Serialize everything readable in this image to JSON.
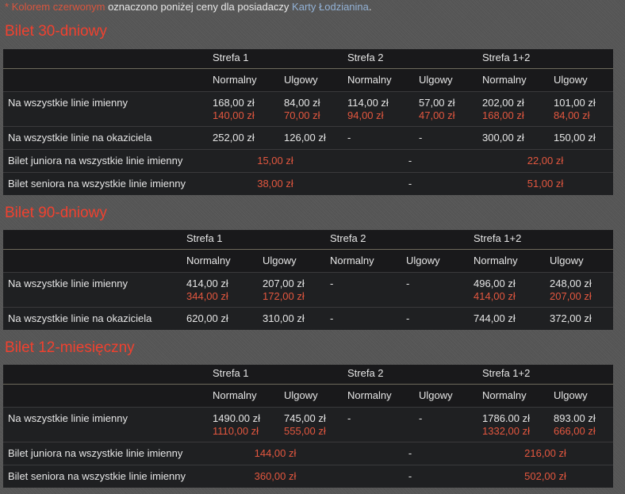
{
  "intro": {
    "star": "*",
    "red_text": "Kolorem czerwonym",
    "text": " oznaczono poniżej ceny dla posiadaczy ",
    "link": "Karty Łodzianina",
    "end": "."
  },
  "colors": {
    "discount": "#e4573f",
    "title": "#f0412f",
    "link": "#93b2d6"
  },
  "sections": [
    {
      "title": "Bilet 30-dniowy",
      "zones": [
        "Strefa 1",
        "Strefa 2",
        "Strefa 1+2"
      ],
      "types": [
        "Normalny",
        "Ulgowy",
        "Normalny",
        "Ulgowy",
        "Normalny",
        "Ulgowy"
      ],
      "rows": [
        {
          "label": "Na wszystkie linie imienny",
          "prices": [
            "168,00 zł",
            "84,00 zł",
            "114,00 zł",
            "57,00 zł",
            "202,00 zł",
            "101,00 zł"
          ],
          "card_prices": [
            "140,00 zł",
            "70,00 zł",
            "94,00 zł",
            "47,00 zł",
            "168,00 zł",
            "84,00 zł"
          ]
        },
        {
          "label": "Na wszystkie linie na okaziciela",
          "prices": [
            "252,00 zł",
            "126,00 zł",
            "-",
            "-",
            "300,00 zł",
            "150,00 zł"
          ]
        },
        {
          "label": "Bilet juniora na wszystkie linie imienny",
          "zone_prices": [
            "15,00 zł",
            "-",
            "22,00 zł"
          ]
        },
        {
          "label": "Bilet seniora na wszystkie linie imienny",
          "zone_prices": [
            "38,00 zł",
            "-",
            "51,00 zł"
          ]
        }
      ]
    },
    {
      "title": "Bilet 90-dniowy",
      "zones": [
        "Strefa 1",
        "Strefa 2",
        "Strefa 1+2"
      ],
      "types": [
        "Normalny",
        "Ulgowy",
        "Normalny",
        "Ulgowy",
        "Normalny",
        "Ulgowy"
      ],
      "rows": [
        {
          "label": "Na wszystkie linie imienny",
          "prices": [
            "414,00 zł",
            "207,00 zł",
            "-",
            "-",
            "496,00 zł",
            "248,00 zł"
          ],
          "card_prices": [
            "344,00 zł",
            "172,00 zł",
            "",
            "",
            "414,00 zł",
            "207,00 zł"
          ]
        },
        {
          "label": "Na wszystkie linie na okaziciela",
          "prices": [
            "620,00 zł",
            "310,00 zł",
            "-",
            "-",
            "744,00 zł",
            "372,00 zł"
          ]
        }
      ]
    },
    {
      "title": "Bilet 12-miesięczny",
      "zones": [
        "Strefa 1",
        "Strefa 2",
        "Strefa 1+2"
      ],
      "types": [
        "Normalny",
        "Ulgowy",
        "Normalny",
        "Ulgowy",
        "Normalny",
        "Ulgowy"
      ],
      "rows": [
        {
          "label": "Na wszystkie linie imienny",
          "prices": [
            "1490.00 zł",
            "745,00 zł",
            "-",
            "-",
            "1786.00 zł",
            "893.00 zł"
          ],
          "card_prices": [
            "1110,00 zł",
            "555,00 zł",
            "",
            "",
            "1332,00 zł",
            "666,00 zł"
          ]
        },
        {
          "label": "Bilet juniora na wszystkie linie imienny",
          "zone_prices": [
            "144,00 zł",
            "-",
            "216,00 zł"
          ]
        },
        {
          "label": "Bilet seniora na wszystkie linie imienny",
          "zone_prices": [
            "360,00 zł",
            "-",
            "502,00 zł"
          ]
        }
      ]
    }
  ]
}
